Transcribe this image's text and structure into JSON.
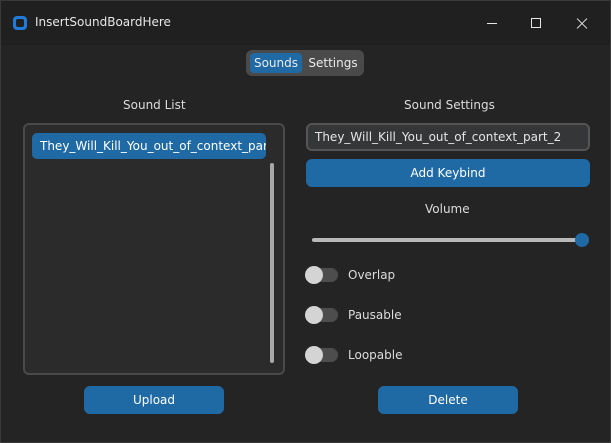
{
  "window": {
    "title": "InsertSoundBoardHere"
  },
  "tabs": {
    "sounds": "Sounds",
    "settings": "Settings"
  },
  "sound_list": {
    "title": "Sound List",
    "items": [
      "They_Will_Kill_You_out_of_context_par"
    ]
  },
  "sound_settings": {
    "title": "Sound Settings",
    "name_value": "They_Will_Kill_You_out_of_context_part_2",
    "add_keybind_label": "Add Keybind",
    "volume_label": "Volume",
    "volume_level": 1.0,
    "toggles": {
      "overlap": "Overlap",
      "pausable": "Pausable",
      "loopable": "Loopable"
    }
  },
  "buttons": {
    "upload": "Upload",
    "delete": "Delete"
  },
  "colors": {
    "accent": "#1f6aa5",
    "background": "#242424",
    "titlebar": "#202020"
  }
}
